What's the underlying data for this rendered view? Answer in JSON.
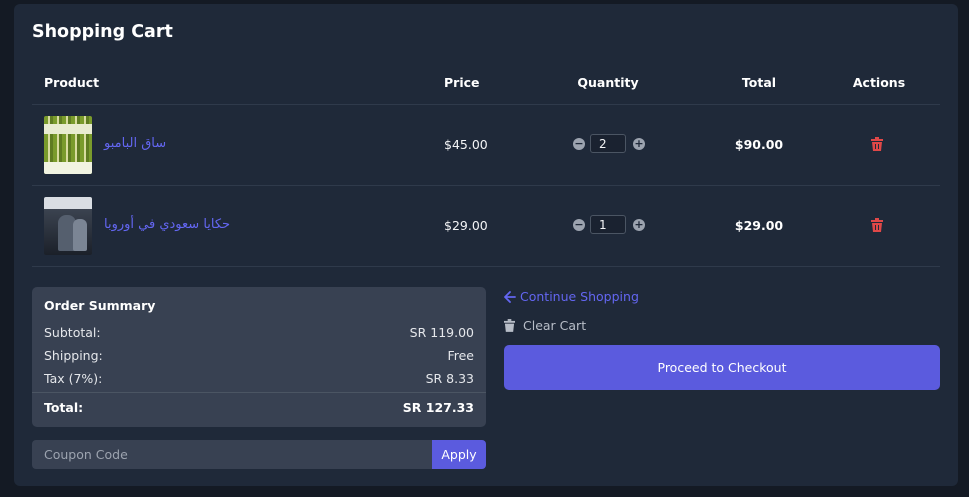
{
  "page": {
    "title": "Shopping Cart"
  },
  "table": {
    "headers": {
      "product": "Product",
      "price": "Price",
      "quantity": "Quantity",
      "total": "Total",
      "actions": "Actions"
    },
    "rows": [
      {
        "name": "ساق البامبو",
        "price": "$45.00",
        "quantity": "2",
        "total": "$90.00",
        "cover_icon": "book-cover-bamboo"
      },
      {
        "name": "حكايا سعودي في أوروبا",
        "price": "$29.00",
        "quantity": "1",
        "total": "$29.00",
        "cover_icon": "book-cover-europe"
      }
    ]
  },
  "summary": {
    "title": "Order Summary",
    "subtotal_label": "Subtotal:",
    "subtotal_value": "SR 119.00",
    "shipping_label": "Shipping:",
    "shipping_value": "Free",
    "tax_label": "Tax (7%):",
    "tax_value": "SR 8.33",
    "total_label": "Total:",
    "total_value": "SR 127.33"
  },
  "coupon": {
    "placeholder": "Coupon Code",
    "value": "",
    "apply_label": "Apply"
  },
  "actions": {
    "continue_label": "Continue Shopping",
    "clear_label": "Clear Cart",
    "checkout_label": "Proceed to Checkout"
  },
  "colors": {
    "accent": "#5b5bde",
    "link": "#6366f1",
    "danger": "#e04848",
    "panel": "#1f2939",
    "summary_bg": "#384152"
  }
}
